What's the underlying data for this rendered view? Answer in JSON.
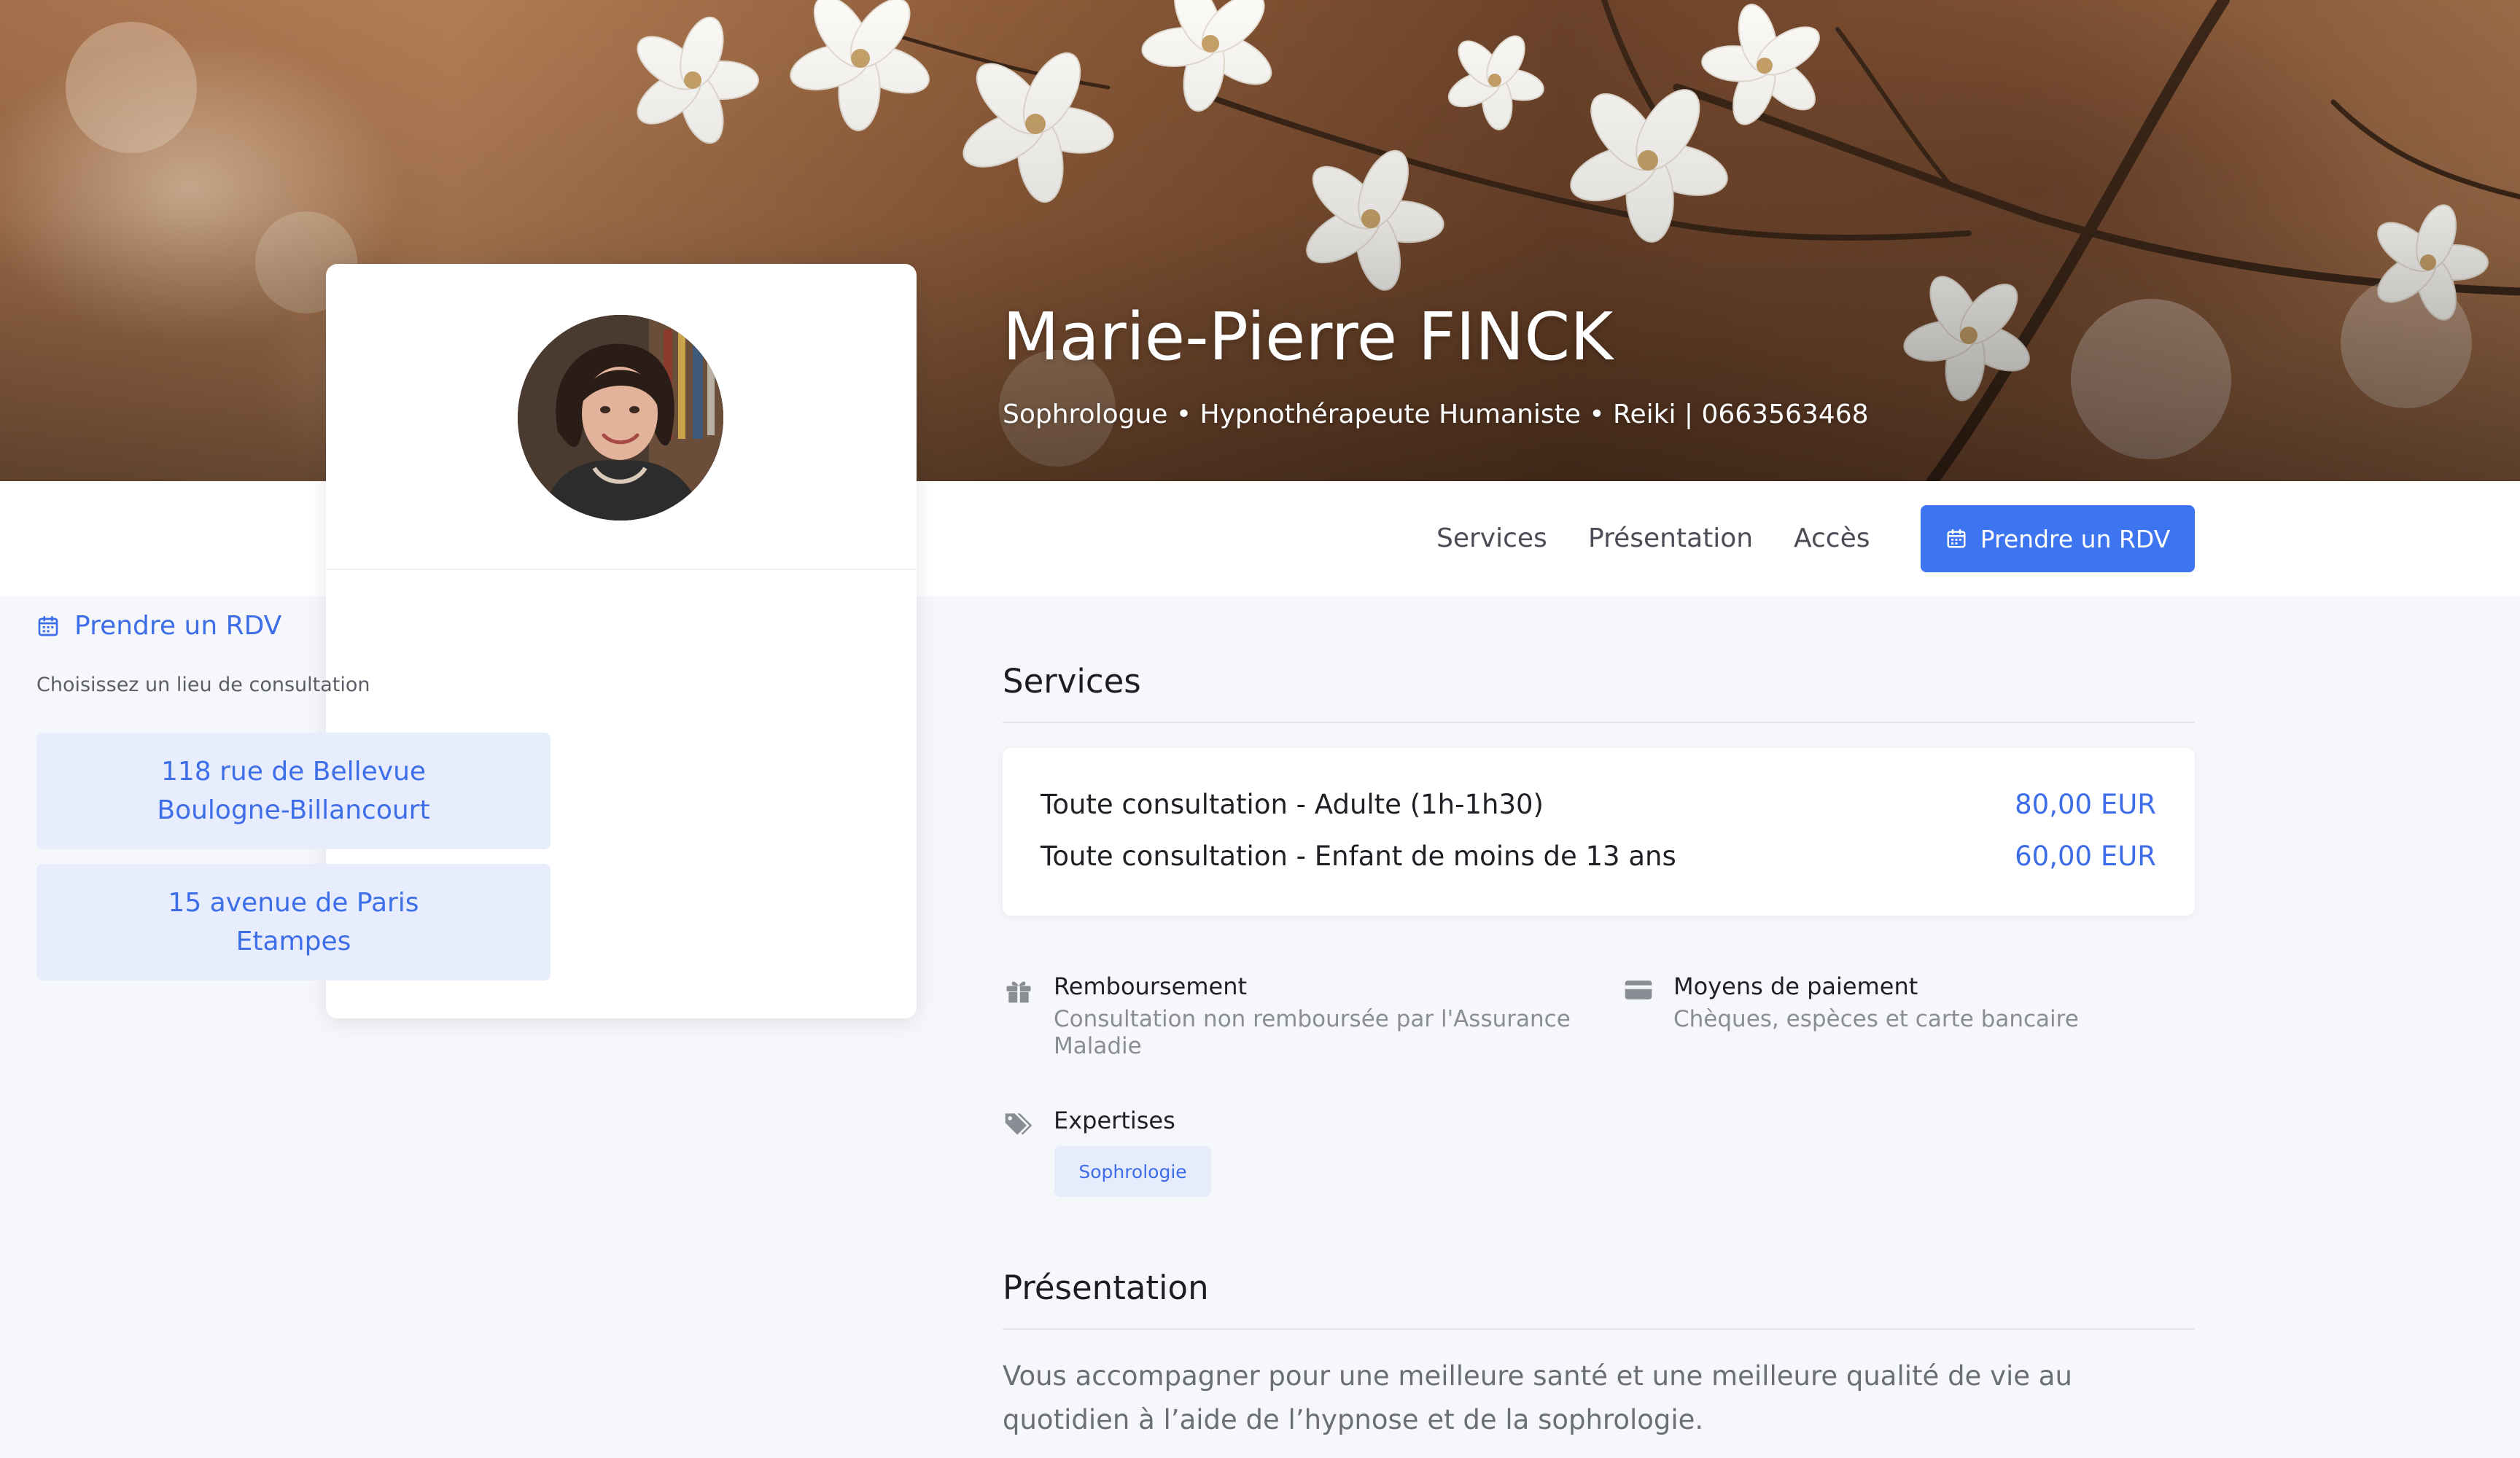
{
  "hero": {
    "name": "Marie-Pierre FINCK",
    "subtitle": "Sophrologue • Hypnothérapeute Humaniste • Reiki | 0663563468"
  },
  "nav": {
    "links": [
      "Services",
      "Présentation",
      "Accès"
    ],
    "cta_label": "Prendre un RDV",
    "cta_icon": "calendar-icon",
    "accent_color": "#3d74f0"
  },
  "card": {
    "rdv_label": "Prendre un RDV",
    "rdv_icon": "calendar-icon",
    "hint": "Choisissez un lieu de consultation",
    "locations": [
      {
        "line1": "118 rue de Bellevue",
        "line2": "Boulogne-Billancourt"
      },
      {
        "line1": "15 avenue de Paris",
        "line2": "Etampes"
      }
    ]
  },
  "services": {
    "title": "Services",
    "items": [
      {
        "name": "Toute consultation - Adulte (1h-1h30)",
        "price": "80,00 EUR"
      },
      {
        "name": "Toute consultation - Enfant de moins de 13 ans",
        "price": "60,00 EUR"
      }
    ],
    "reimbursement": {
      "title": "Remboursement",
      "desc": "Consultation non remboursée par l'Assurance Maladie",
      "icon": "gift-icon"
    },
    "payment": {
      "title": "Moyens de paiement",
      "desc": "Chèques, espèces et carte bancaire",
      "icon": "credit-card-icon"
    },
    "expertises": {
      "title": "Expertises",
      "icon": "tags-icon",
      "tags": [
        "Sophrologie"
      ]
    }
  },
  "presentation": {
    "title": "Présentation",
    "text": "Vous accompagner pour une meilleure santé et une meilleure qualité de vie au quotidien à l’aide de l’hypnose et de la sophrologie."
  }
}
